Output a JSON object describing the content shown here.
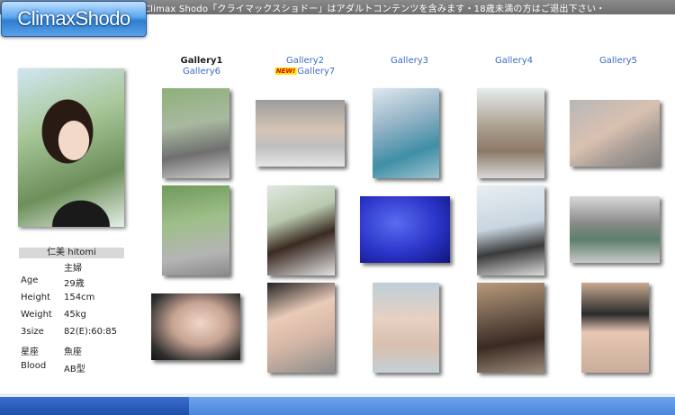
{
  "header": {
    "logo": "ClimaxShodo",
    "notice": "Climax Shodo「クライマックスショドー」はアダルトコンテンツを含みます・18歳未満の方はご退出下さい・"
  },
  "nav": {
    "galleries": [
      "Gallery1",
      "Gallery2",
      "Gallery3",
      "Gallery4",
      "Gallery5",
      "Gallery6",
      "Gallery7"
    ],
    "current": "Gallery1",
    "new_badge": "NEW!"
  },
  "profile": {
    "name": "仁美 hitomi",
    "occupation": "主婦",
    "rows": [
      {
        "label": "Age",
        "value": "29歳"
      },
      {
        "label": "Height",
        "value": "154cm"
      },
      {
        "label": "Weight",
        "value": "45kg"
      },
      {
        "label": "3size",
        "value": "82(E):60:85"
      },
      {
        "label": "星座",
        "value": "魚座"
      },
      {
        "label": "Blood",
        "value": "AB型"
      }
    ]
  },
  "colors": {
    "link": "#3a6cc8",
    "header_bg": "#7a7a7a",
    "logo_blue": "#3a8ade",
    "footer_dark": "#2a5cbc",
    "footer_light": "#5a94e4"
  }
}
